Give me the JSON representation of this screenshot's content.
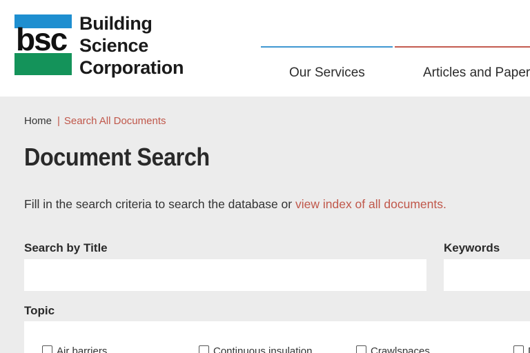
{
  "header": {
    "logo": {
      "mark_text": "bsc",
      "name_lines": [
        "Building",
        "Science",
        "Corporation"
      ]
    },
    "nav": [
      {
        "label": "Our Services"
      },
      {
        "label": "Articles and Papers"
      }
    ],
    "colors": {
      "accent_blue": "#3e97d1",
      "accent_red": "#c35b4f",
      "logo_green": "#14935a"
    }
  },
  "breadcrumb": {
    "home": "Home",
    "separator": "|",
    "current": "Search All Documents"
  },
  "main": {
    "title": "Document Search",
    "intro_text": "Fill in the search criteria to search the database or ",
    "intro_link": "view index of all documents.",
    "search_title_label": "Search by Title",
    "search_title_value": "",
    "keywords_label": "Keywords",
    "keywords_value": "",
    "topic_label": "Topic",
    "topics": [
      {
        "label": "Air barriers",
        "checked": false
      },
      {
        "label": "Continuous insulation",
        "checked": false
      },
      {
        "label": "Crawlspaces",
        "checked": false
      },
      {
        "label": "D",
        "checked": false
      }
    ]
  }
}
